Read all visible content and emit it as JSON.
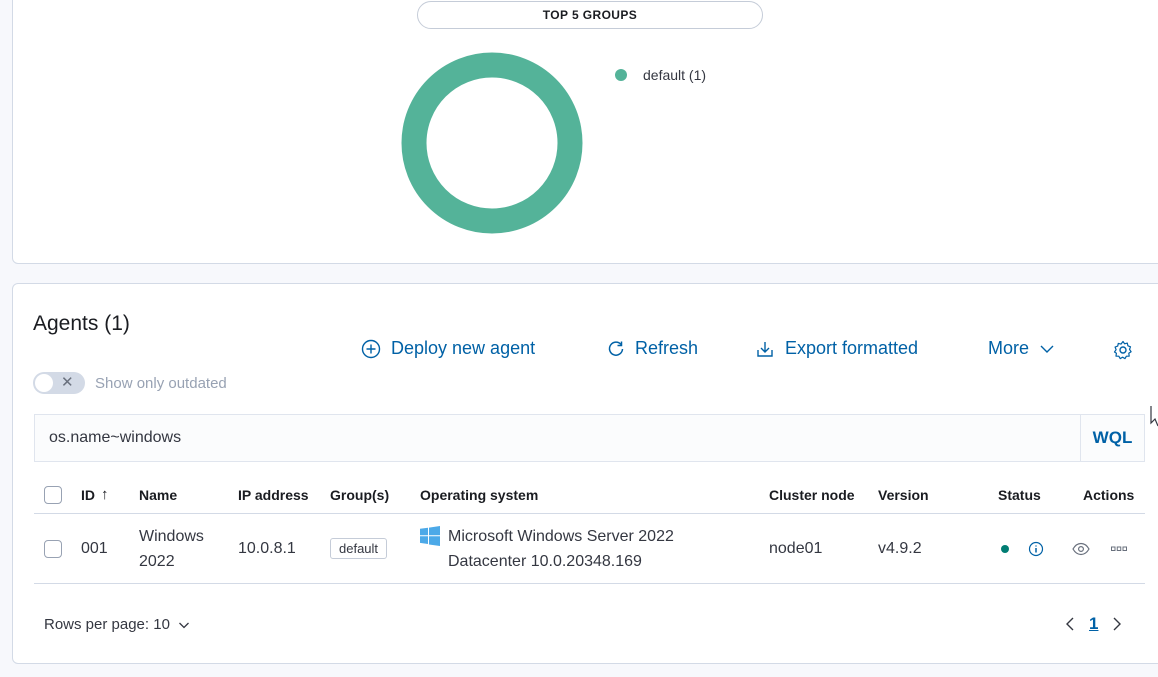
{
  "groups_panel": {
    "title": "TOP 5 GROUPS",
    "legend": [
      {
        "label": "default (1)",
        "color": "#54b399"
      }
    ]
  },
  "agents": {
    "title": "Agents (1)",
    "toggle_label": "Show only outdated",
    "actions": {
      "deploy": "Deploy new agent",
      "refresh": "Refresh",
      "export": "Export formatted",
      "more": "More"
    },
    "search": {
      "value": "os.name~windows",
      "wql_label": "WQL"
    },
    "columns": {
      "id": "ID",
      "name": "Name",
      "ip": "IP address",
      "groups": "Group(s)",
      "os": "Operating system",
      "cluster": "Cluster node",
      "version": "Version",
      "status": "Status",
      "actions": "Actions"
    },
    "rows": [
      {
        "id": "001",
        "name_line1": "Windows",
        "name_line2": "2022",
        "ip": "10.0.8.1",
        "group": "default",
        "os_line1": "Microsoft Windows Server 2022",
        "os_line2": "Datacenter 10.0.20348.169",
        "cluster": "node01",
        "version": "v4.9.2",
        "status_color": "#017d73"
      }
    ],
    "rows_per_page": "Rows per page: 10",
    "current_page": "1"
  },
  "colors": {
    "accent": "#0061a6",
    "donut": "#54b399",
    "windows": "#4ca9e8"
  }
}
